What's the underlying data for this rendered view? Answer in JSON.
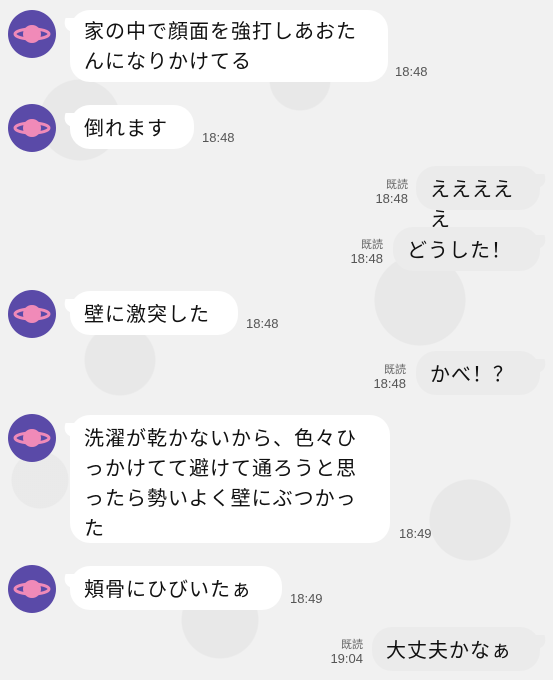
{
  "chat": {
    "messages": [
      {
        "side": "in",
        "text": "家の中で顔面を強打しあおたんになりかけてる",
        "time": "18:48"
      },
      {
        "side": "in",
        "text": "倒れます",
        "time": "18:48"
      },
      {
        "side": "out",
        "text": "えええええ",
        "time": "18:48",
        "read": "既読"
      },
      {
        "side": "out",
        "text": "どうした！",
        "time": "18:48",
        "read": "既読"
      },
      {
        "side": "in",
        "text": "壁に激突した",
        "time": "18:48"
      },
      {
        "side": "out",
        "text": "かべ！？",
        "time": "18:48",
        "read": "既読"
      },
      {
        "side": "in",
        "text": "洗濯が乾かないから、色々ひっかけてて避けて通ろうと思ったら勢いよく壁にぶつかった",
        "time": "18:49"
      },
      {
        "side": "in",
        "text": "頬骨にひびいたぁ",
        "time": "18:49"
      },
      {
        "side": "out",
        "text": "大丈夫かなぁ",
        "time": "19:04",
        "read": "既読"
      }
    ]
  },
  "colors": {
    "avatar": "#5a4aa8",
    "avatar_planet": "#f08ab8",
    "incoming_bubble": "#ffffff",
    "outgoing_bubble": "#ebebeb"
  },
  "icons": {
    "avatar": "planet-icon"
  }
}
